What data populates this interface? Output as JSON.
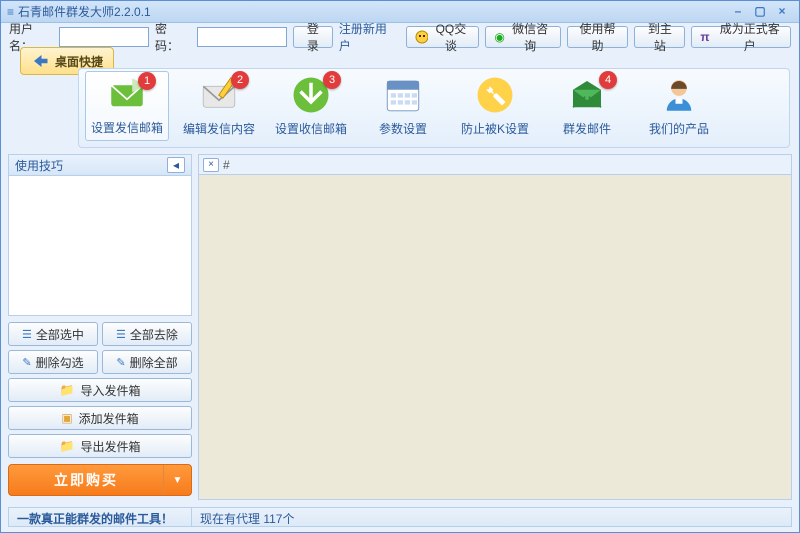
{
  "window": {
    "title": "石青邮件群发大师2.2.0.1"
  },
  "login": {
    "username_label": "用户名：",
    "password_label": "密    码：",
    "login_btn": "登录",
    "register_link": "注册新用户"
  },
  "topbtns": {
    "desktop_shortcut": "桌面快捷",
    "qq_chat": "QQ交谈",
    "wechat_consult": "微信咨询",
    "use_help": "使用帮助",
    "to_mainsite": "到主站",
    "become_customer": "成为正式客户"
  },
  "toolbar": [
    {
      "key": "set-send-mailbox",
      "label": "设置发信邮箱",
      "badge": "1",
      "icon": "mail-green",
      "active": true
    },
    {
      "key": "edit-send-content",
      "label": "编辑发信内容",
      "badge": "2",
      "icon": "mail-edit"
    },
    {
      "key": "set-recv-mailbox",
      "label": "设置收信邮箱",
      "badge": "3",
      "icon": "mail-recv"
    },
    {
      "key": "param-settings",
      "label": "参数设置",
      "icon": "calendar"
    },
    {
      "key": "anti-k-settings",
      "label": "防止被K设置",
      "icon": "wrench"
    },
    {
      "key": "mass-send",
      "label": "群发邮件",
      "badge": "4",
      "icon": "envelope-green"
    },
    {
      "key": "our-products",
      "label": "我们的产品",
      "icon": "person"
    }
  ],
  "sidebar": {
    "tips_title": "使用技巧",
    "select_all": "全部选中",
    "remove_all": "全部去除",
    "delete_checked": "删除勾选",
    "delete_all": "删除全部",
    "import_sendbox": "导入发件箱",
    "add_sendbox": "添加发件箱",
    "export_sendbox": "导出发件箱",
    "buy_now": "立即购买"
  },
  "content_tabs": {
    "hash": "#"
  },
  "status": {
    "left": "一款真正能群发的邮件工具！",
    "right": "现在有代理 117个"
  },
  "colors": {
    "accent": "#2b5a9b",
    "orange": "#f77b1c",
    "badge": "#e23b3b"
  }
}
